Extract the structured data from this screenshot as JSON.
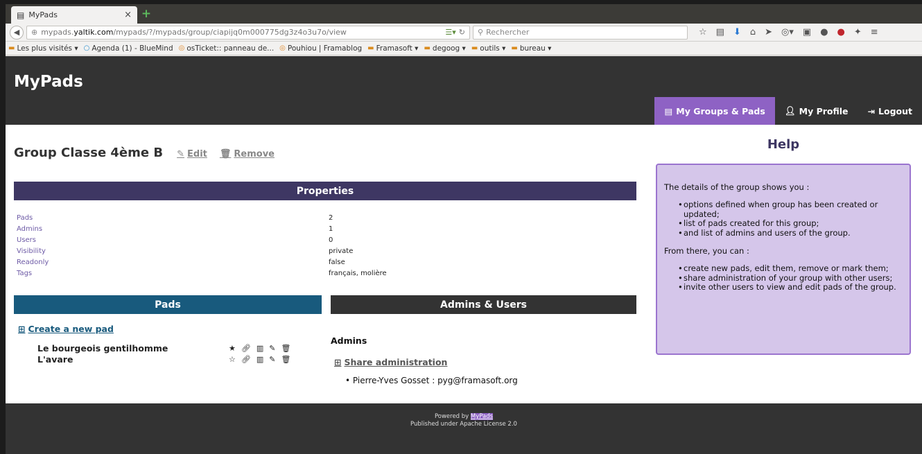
{
  "browser": {
    "tab_title": "MyPads",
    "url_prefix": "mypads.",
    "url_domain": "yaltik.com",
    "url_path": "/mypads/?/mypads/group/ciapijq0m000775dg3z4o3u7o/view",
    "search_placeholder": "Rechercher",
    "bookmarks": [
      {
        "label": "Les plus visités ▾",
        "icon": "folder-icon"
      },
      {
        "label": "Agenda (1) - BlueMind",
        "icon": "calendar-icon"
      },
      {
        "label": "osTicket:: panneau de...",
        "icon": "ticket-icon"
      },
      {
        "label": "Pouhiou | Framablog",
        "icon": "blog-icon"
      },
      {
        "label": "Framasoft ▾",
        "icon": "folder-icon"
      },
      {
        "label": "degoog ▾",
        "icon": "folder-icon"
      },
      {
        "label": "outils ▾",
        "icon": "folder-icon"
      },
      {
        "label": "bureau ▾",
        "icon": "folder-icon"
      }
    ]
  },
  "header": {
    "brand": "MyPads",
    "nav": [
      {
        "label": "My Groups & Pads",
        "active": true
      },
      {
        "label": "My Profile",
        "active": false
      },
      {
        "label": "Logout",
        "active": false
      }
    ]
  },
  "group": {
    "title": "Group Classe 4ème B",
    "edit_label": "Edit",
    "remove_label": "Remove",
    "properties_heading": "Properties",
    "properties": [
      {
        "key": "Pads",
        "value": "2"
      },
      {
        "key": "Admins",
        "value": "1"
      },
      {
        "key": "Users",
        "value": "0"
      },
      {
        "key": "Visibility",
        "value": "private"
      },
      {
        "key": "Readonly",
        "value": "false"
      },
      {
        "key": "Tags",
        "value": "français, molière"
      }
    ],
    "pads_heading": "Pads",
    "create_pad_label": "Create a new pad",
    "pads": [
      {
        "name": "Le bourgeois gentilhomme",
        "starred": true
      },
      {
        "name": "L'avare",
        "starred": false
      }
    ],
    "admins_users_heading": "Admins & Users",
    "admins_title": "Admins",
    "share_admin_label": "Share administration",
    "admins": [
      "Pierre-Yves Gosset : pyg@framasoft.org"
    ]
  },
  "help": {
    "title": "Help",
    "intro": "The details of the group shows you :",
    "list1": [
      "options defined when group has been created or updated;",
      "list of pads created for this group;",
      "and list of admins and users of the group."
    ],
    "from_there": "From there, you can :",
    "list2": [
      "create new pads, edit them, remove or mark them;",
      "share administration of your group with other users;",
      "invite other users to view and edit pads of the group."
    ]
  },
  "footer": {
    "powered_prefix": "Powered by ",
    "powered_link": "MyPads",
    "license": "Published under Apache License 2.0"
  }
}
